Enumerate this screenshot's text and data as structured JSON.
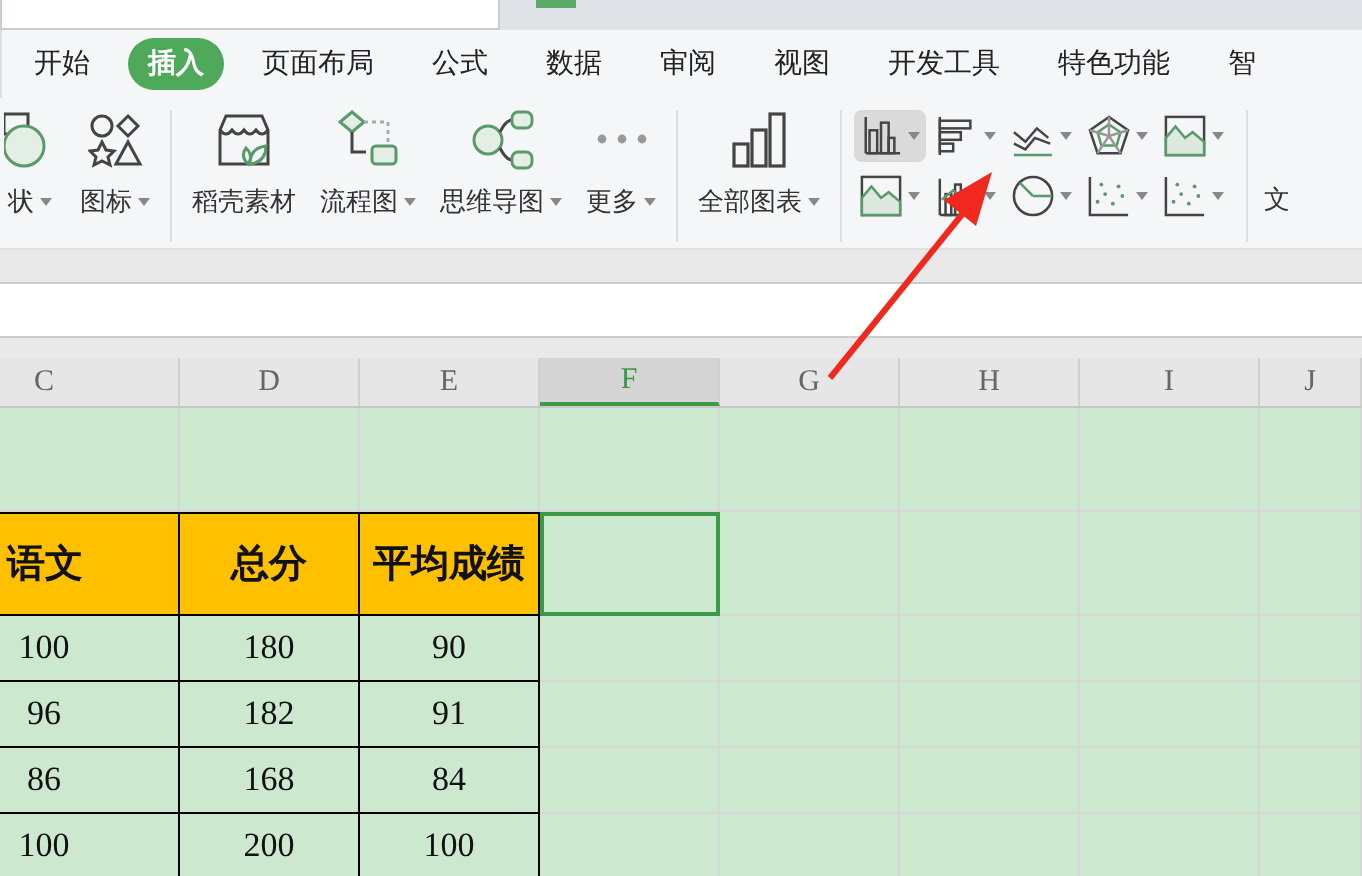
{
  "ribbon_tabs": [
    {
      "label": "开始",
      "selected": false
    },
    {
      "label": "插入",
      "selected": true
    },
    {
      "label": "页面布局",
      "selected": false
    },
    {
      "label": "公式",
      "selected": false
    },
    {
      "label": "数据",
      "selected": false
    },
    {
      "label": "审阅",
      "selected": false
    },
    {
      "label": "视图",
      "selected": false
    },
    {
      "label": "开发工具",
      "selected": false
    },
    {
      "label": "特色功能",
      "selected": false
    },
    {
      "label": "智",
      "selected": false
    }
  ],
  "tools": [
    {
      "kind": "shape",
      "label": "状",
      "dropdown": true
    },
    {
      "kind": "icons",
      "label": "图标",
      "dropdown": true
    },
    {
      "kind": "template",
      "label": "稻壳素材",
      "dropdown": false
    },
    {
      "kind": "flowchart",
      "label": "流程图",
      "dropdown": true
    },
    {
      "kind": "mindmap",
      "label": "思维导图",
      "dropdown": true
    },
    {
      "kind": "more",
      "label": "更多",
      "dropdown": true
    },
    {
      "kind": "allcharts",
      "label": "全部图表",
      "dropdown": true
    }
  ],
  "chart_buttons": [
    {
      "kind": "column",
      "highlighted": true
    },
    {
      "kind": "bar",
      "highlighted": false
    },
    {
      "kind": "line",
      "highlighted": false
    },
    {
      "kind": "radar",
      "highlighted": false
    },
    {
      "kind": "area",
      "highlighted": false
    },
    {
      "kind": "area",
      "highlighted": false
    },
    {
      "kind": "combo",
      "highlighted": false
    },
    {
      "kind": "pie",
      "highlighted": false
    },
    {
      "kind": "scatter",
      "highlighted": false
    },
    {
      "kind": "scatter",
      "highlighted": false
    }
  ],
  "ribbon_edge_label": "文",
  "sheet": {
    "columns": [
      {
        "label": "C",
        "selected": false
      },
      {
        "label": "D",
        "selected": false
      },
      {
        "label": "E",
        "selected": false
      },
      {
        "label": "F",
        "selected": true
      },
      {
        "label": "G",
        "selected": false
      },
      {
        "label": "H",
        "selected": false
      },
      {
        "label": "I",
        "selected": false
      },
      {
        "label": "J",
        "selected": false
      }
    ],
    "rows": [
      {
        "kind": "blank",
        "selected": false
      },
      {
        "kind": "header",
        "selected": true,
        "cells": [
          "语文",
          "总分",
          "平均成绩"
        ]
      },
      {
        "kind": "data",
        "selected": false,
        "cells": [
          "100",
          "180",
          "90"
        ]
      },
      {
        "kind": "data",
        "selected": false,
        "cells": [
          "96",
          "182",
          "91"
        ]
      },
      {
        "kind": "data",
        "selected": false,
        "cells": [
          "86",
          "168",
          "84"
        ]
      },
      {
        "kind": "data",
        "selected": false,
        "cells": [
          "100",
          "200",
          "100"
        ]
      }
    ]
  }
}
